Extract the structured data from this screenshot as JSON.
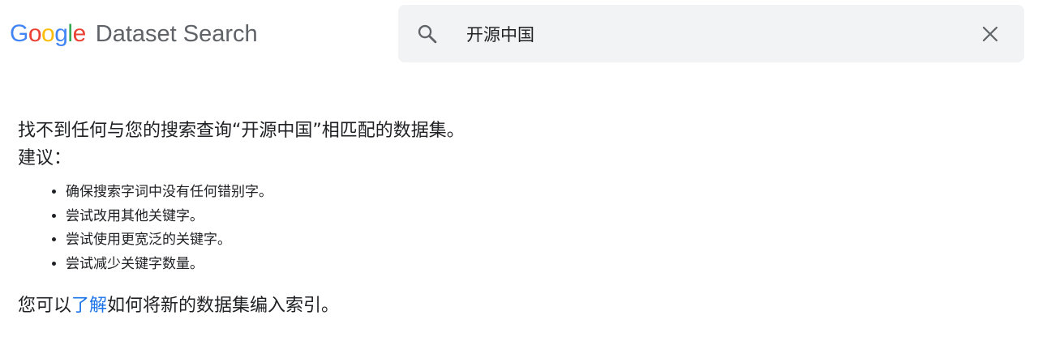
{
  "header": {
    "logo_letters": [
      {
        "char": "G",
        "color": "#4285F4"
      },
      {
        "char": "o",
        "color": "#EA4335"
      },
      {
        "char": "o",
        "color": "#FBBC05"
      },
      {
        "char": "g",
        "color": "#4285F4"
      },
      {
        "char": "l",
        "color": "#34A853"
      },
      {
        "char": "e",
        "color": "#EA4335"
      }
    ],
    "product_name": "Dataset Search",
    "search": {
      "value": "开源中国",
      "search_icon": "search-icon",
      "clear_icon": "close-icon"
    }
  },
  "main": {
    "no_result_message": "找不到任何与您的搜索查询“开源中国”相匹配的数据集。",
    "suggestions_title": "建议：",
    "suggestions": [
      "确保搜索字词中没有任何错别字。",
      "尝试改用其他关键字。",
      "尝试使用更宽泛的关键字。",
      "尝试减少关键字数量。"
    ],
    "footer_prefix": "您可以",
    "footer_link": "了解",
    "footer_suffix": "如何将新的数据集编入索引。"
  },
  "colors": {
    "link": "#1a73e8",
    "search_bg": "#f1f3f4",
    "text": "#202124",
    "muted": "#5f6368"
  }
}
